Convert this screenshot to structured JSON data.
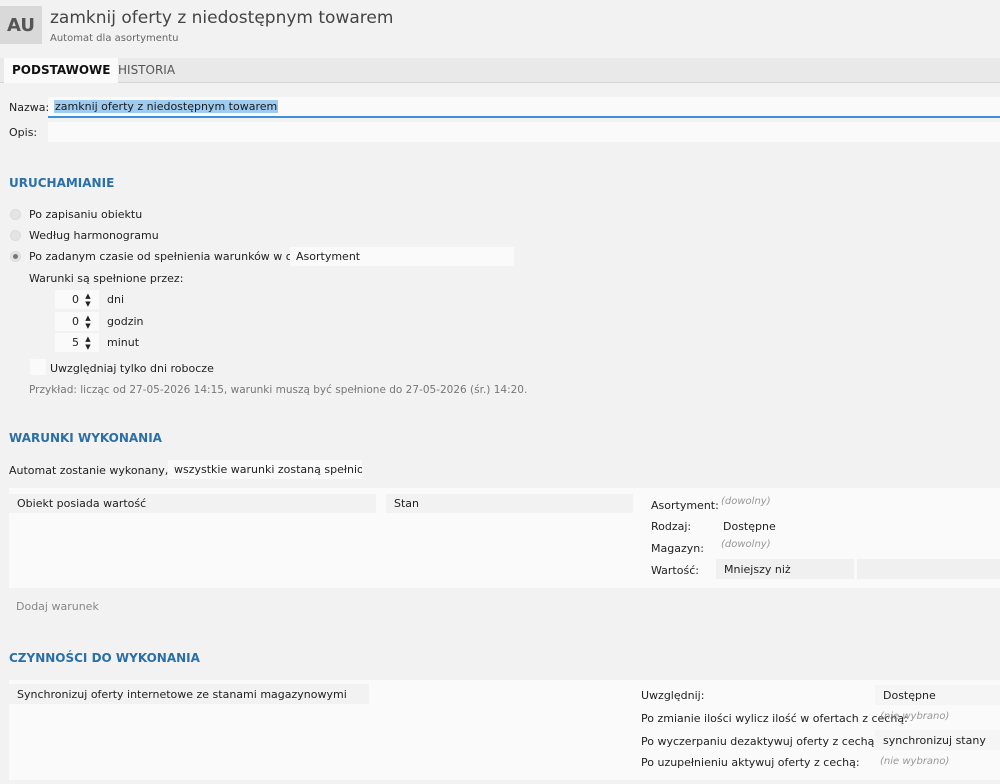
{
  "header": {
    "avatar": "AU",
    "title": "zamknij oferty z niedostępnym towarem",
    "subtitle": "Automat dla asortymentu"
  },
  "tabs": [
    {
      "label": "PODSTAWOWE",
      "active": true
    },
    {
      "label": "HISTORIA",
      "active": false
    }
  ],
  "form": {
    "name_label": "Nazwa:",
    "name_value": "zamknij oferty z niedostępnym towarem",
    "desc_label": "Opis:",
    "desc_value": ""
  },
  "trigger": {
    "section_title": "URUCHAMIANIE",
    "options": [
      {
        "label": "Po zapisaniu obiektu",
        "checked": false
      },
      {
        "label": "Według harmonogramu",
        "checked": false
      },
      {
        "label": "Po zadanym czasie od spełnienia warunków w obiekcie",
        "checked": true
      }
    ],
    "object_value": "Asortyment",
    "conditions_met_label": "Warunki są spełnione przez:",
    "days_value": "0",
    "days_label": "dni",
    "hours_value": "0",
    "hours_label": "godzin",
    "minutes_value": "5",
    "minutes_label": "minut",
    "workdays_label": "Uwzględniaj tylko dni robocze",
    "workdays_checked": false,
    "example_text": "Przykład: licząc od 27-05-2026 14:15, warunki muszą być spełnione do 27-05-2026 (śr.) 14:20."
  },
  "conditions": {
    "section_title": "WARUNKI WYKONANIA",
    "when_label": "Automat zostanie wykonany, gdy",
    "when_value": "wszystkie warunki zostaną spełnione",
    "condition_type": "Obiekt posiada wartość",
    "condition_field": "Stan",
    "assortment_label": "Asortyment:",
    "assortment_value": "(dowolny)",
    "kind_label": "Rodzaj:",
    "kind_value": "Dostępne",
    "warehouse_label": "Magazyn:",
    "warehouse_value": "(dowolny)",
    "value_label": "Wartość:",
    "value_operator": "Mniejszy niż",
    "value_amount": "",
    "add_condition": "Dodaj warunek"
  },
  "actions": {
    "section_title": "CZYNNOŚCI DO WYKONANIA",
    "action_type": "Synchronizuj oferty internetowe ze stanami magazynowymi",
    "include_label": "Uwzględnij:",
    "include_value": "Dostępne",
    "after_change_label": "Po zmianie ilości wylicz ilość w ofertach z cechą:",
    "after_change_value": "(nie wybrano)",
    "after_depletion_label": "Po wyczerpaniu dezaktywuj oferty z cechą:",
    "after_depletion_value": "synchronizuj stany",
    "after_refill_label": "Po uzupełnieniu aktywuj oferty z cechą:",
    "after_refill_value": "(nie wybrano)"
  },
  "colors": {
    "accent": "#2a6fa8",
    "selection": "#9ecbf0",
    "focus_border": "#3c8fd8"
  }
}
